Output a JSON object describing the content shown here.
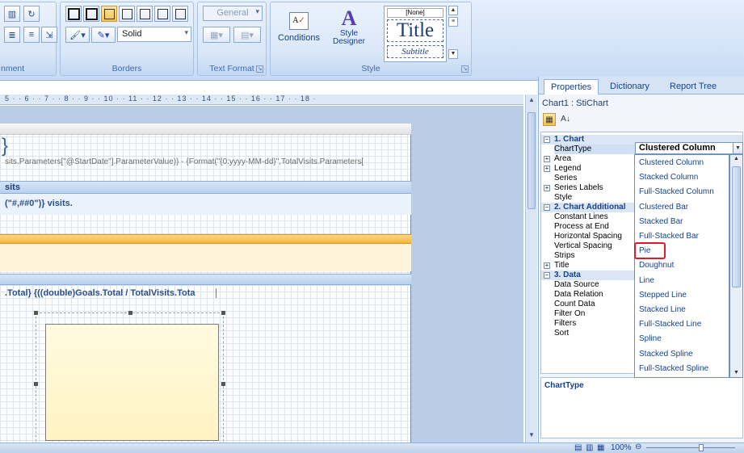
{
  "ribbon": {
    "alignment_label": "nment",
    "borders_label": "Borders",
    "border_style": "Solid",
    "text_format_label": "Text Format",
    "text_format_value": "General",
    "style_group_label": "Style",
    "conditions_label": "Conditions",
    "style_designer_label": "Style\nDesigner",
    "style_gallery": {
      "none": "[None]",
      "title": "Title",
      "subtitle": "Subtitle"
    }
  },
  "ruler": {
    "ticks": "5 · · 6 · · 7 · · 8 · · 9 · · 10 · · 11 · · 12 · · 13 · · 14 · · 15 · · 16 · · 17 · · 18 ·"
  },
  "report": {
    "brace": "}",
    "params_expr": "sits.Parameters[\"@StartDate\"].ParameterValue)} - {Format(\"{0:yyyy-MM-dd}\",TotalVisits.Parameters[",
    "band1_header": "sits",
    "visits_expr": "(\"#,##0\")} visits.",
    "goals_expr": ".Total}  {((double)Goals.Total / TotalVisits.Tota"
  },
  "panel": {
    "tabs": [
      "Properties",
      "Dictionary",
      "Report Tree"
    ],
    "object_name": "Chart1 : StiChart",
    "rows": [
      {
        "label": "1. Chart",
        "type": "category",
        "expander": "−"
      },
      {
        "label": "ChartType",
        "type": "selected"
      },
      {
        "label": "Area",
        "type": "expandable",
        "expander": "+"
      },
      {
        "label": "Legend",
        "type": "expandable",
        "expander": "+"
      },
      {
        "label": "Series",
        "type": "plain"
      },
      {
        "label": "Series Labels",
        "type": "expandable",
        "expander": "+"
      },
      {
        "label": "Style",
        "type": "plain"
      },
      {
        "label": "2. Chart Additional",
        "type": "category",
        "expander": "−"
      },
      {
        "label": "Constant Lines",
        "type": "plain"
      },
      {
        "label": "Process at End",
        "type": "plain"
      },
      {
        "label": "Horizontal Spacing",
        "type": "plain"
      },
      {
        "label": "Vertical Spacing",
        "type": "plain"
      },
      {
        "label": "Strips",
        "type": "plain"
      },
      {
        "label": "Title",
        "type": "expandable",
        "expander": "+"
      },
      {
        "label": "3. Data",
        "type": "category",
        "expander": "−"
      },
      {
        "label": "Data Source",
        "type": "plain"
      },
      {
        "label": "Data Relation",
        "type": "plain"
      },
      {
        "label": "Count Data",
        "type": "plain"
      },
      {
        "label": "Filter On",
        "type": "plain"
      },
      {
        "label": "Filters",
        "type": "plain"
      },
      {
        "label": "Sort",
        "type": "plain"
      }
    ],
    "description": "ChartType"
  },
  "dropdown": {
    "value": "Clustered Column",
    "options": [
      "Clustered Column",
      "Stacked Column",
      "Full-Stacked Column",
      "Clustered Bar",
      "Stacked Bar",
      "Full-Stacked Bar",
      "Pie",
      "Doughnut",
      "Line",
      "Stepped Line",
      "Stacked Line",
      "Full-Stacked Line",
      "Spline",
      "Stacked Spline",
      "Full-Stacked Spline"
    ],
    "highlighted": "Pie",
    "highlight_color": "#e0192d"
  },
  "status": {
    "zoom": "100%"
  }
}
